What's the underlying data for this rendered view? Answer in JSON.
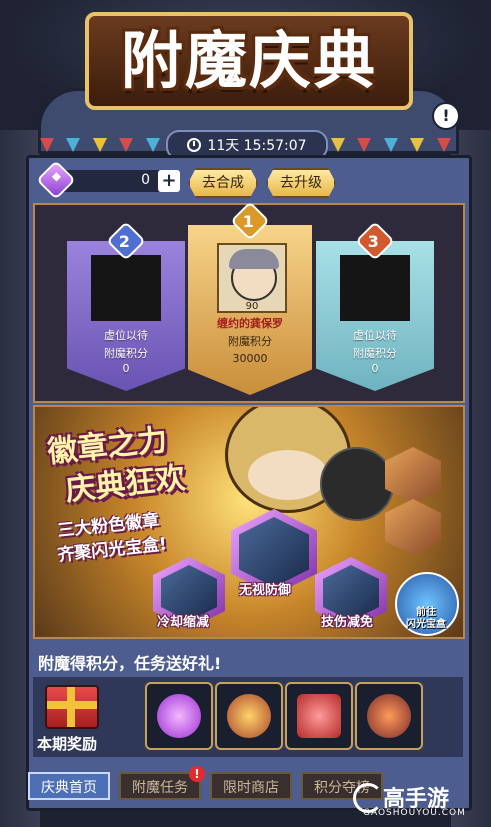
{
  "header": {
    "title": "附魔庆典",
    "countdown": "11天 15:57:07"
  },
  "currency": {
    "value": "0"
  },
  "buttons": {
    "compose": "去合成",
    "upgrade": "去升级"
  },
  "ranking": [
    {
      "rank": "2",
      "name": "虚位以待",
      "score_label": "附魔积分",
      "score": "0"
    },
    {
      "rank": "1",
      "level": "90",
      "name": "缠约的龚保罗",
      "score_label": "附魔积分",
      "score": "30000"
    },
    {
      "rank": "3",
      "name": "虚位以待",
      "score_label": "附魔积分",
      "score": "0"
    }
  ],
  "event": {
    "title_line1": "徽章之力",
    "title_line2": "庆典狂欢",
    "sub_line1": "三大粉色徽章",
    "sub_line2": "齐聚闪光宝盒!",
    "badges": [
      "冷却缩减",
      "无视防御",
      "技伤减免"
    ],
    "goto_line1": "前往",
    "goto_line2": "闪光宝盒"
  },
  "reward": {
    "slogan": "附魔得积分，任务送好礼!",
    "label": "本期奖励"
  },
  "tabs": [
    "庆典首页",
    "附魔任务",
    "限时商店",
    "积分夺榜"
  ],
  "tab_badge": "!",
  "info_badge": "!",
  "watermark": {
    "brand": "高手游",
    "url": "GAOSHOUYOU.COM"
  }
}
